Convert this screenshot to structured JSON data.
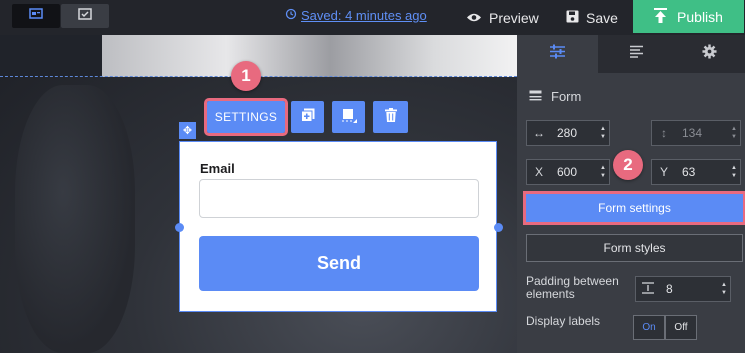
{
  "topbar": {
    "view_toggle": [
      {
        "name": "desktop-view",
        "icon": "desktop-icon"
      },
      {
        "name": "mobile-view",
        "icon": "mobile-icon"
      }
    ],
    "saved_text": "Saved: 4 minutes ago",
    "preview_label": "Preview",
    "save_label": "Save",
    "publish_label": "Publish"
  },
  "toolbar": {
    "settings_label": "SETTINGS",
    "duplicate_icon": "duplicate-icon",
    "layer_icon": "layer-icon",
    "delete_icon": "trash-icon"
  },
  "markers": {
    "one": "1",
    "two": "2"
  },
  "form_widget": {
    "email_label": "Email",
    "email_value": "",
    "send_label": "Send"
  },
  "panel": {
    "tabs": [
      {
        "name": "tab-design",
        "icon": "sliders-icon",
        "active": true
      },
      {
        "name": "tab-text",
        "icon": "text-align-icon",
        "active": false
      },
      {
        "name": "tab-settings",
        "icon": "gear-icon",
        "active": false
      }
    ],
    "section_title": "Form",
    "width_value": "280",
    "height_value": "134",
    "x_label": "X",
    "x_value": "600",
    "y_label": "Y",
    "y_value": "63",
    "form_settings_label": "Form settings",
    "form_styles_label": "Form styles",
    "padding_label": "Padding between elements",
    "padding_value": "8",
    "display_labels_label": "Display labels",
    "on_label": "On",
    "off_label": "Off"
  },
  "colors": {
    "accent": "#5b8bf5",
    "publish": "#3fbf86",
    "highlight": "#e86a7f",
    "panel_bg": "#3a3d44"
  }
}
